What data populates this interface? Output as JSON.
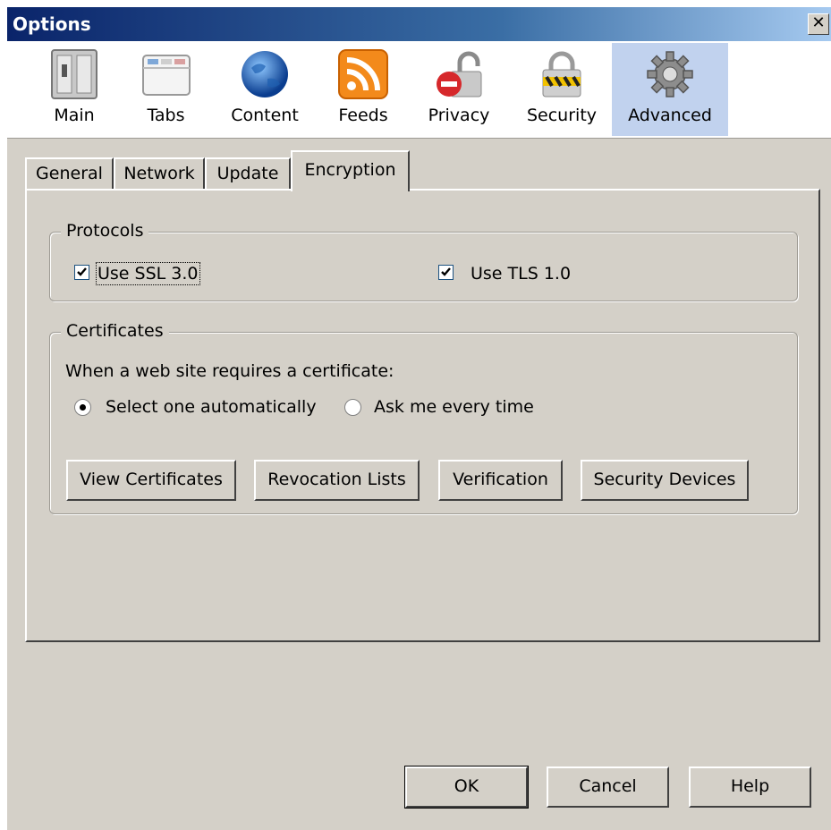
{
  "window": {
    "title": "Options",
    "close_label": "✕"
  },
  "panes": [
    {
      "label": "Main",
      "icon": "main-switch-icon"
    },
    {
      "label": "Tabs",
      "icon": "tabs-window-icon"
    },
    {
      "label": "Content",
      "icon": "globe-icon"
    },
    {
      "label": "Feeds",
      "icon": "rss-feed-icon"
    },
    {
      "label": "Privacy",
      "icon": "privacy-lock-icon"
    },
    {
      "label": "Security",
      "icon": "security-padlock-icon"
    },
    {
      "label": "Advanced",
      "icon": "gear-icon",
      "selected": true
    }
  ],
  "tabs": [
    {
      "label": "General"
    },
    {
      "label": "Network"
    },
    {
      "label": "Update"
    },
    {
      "label": "Encryption",
      "active": true
    }
  ],
  "protocols": {
    "legend": "Protocols",
    "ssl": {
      "label": "Use SSL 3.0",
      "checked": true
    },
    "tls": {
      "label": "Use TLS 1.0",
      "checked": true
    }
  },
  "certificates": {
    "legend": "Certificates",
    "prompt": "When a web site requires a certificate:",
    "option_auto": {
      "label": "Select one automatically",
      "selected": true
    },
    "option_ask": {
      "label": "Ask me every time",
      "selected": false
    },
    "buttons": {
      "view": "View Certificates",
      "revocation": "Revocation Lists",
      "verification": "Verification",
      "devices": "Security Devices"
    }
  },
  "footer": {
    "ok": "OK",
    "cancel": "Cancel",
    "help": "Help"
  }
}
